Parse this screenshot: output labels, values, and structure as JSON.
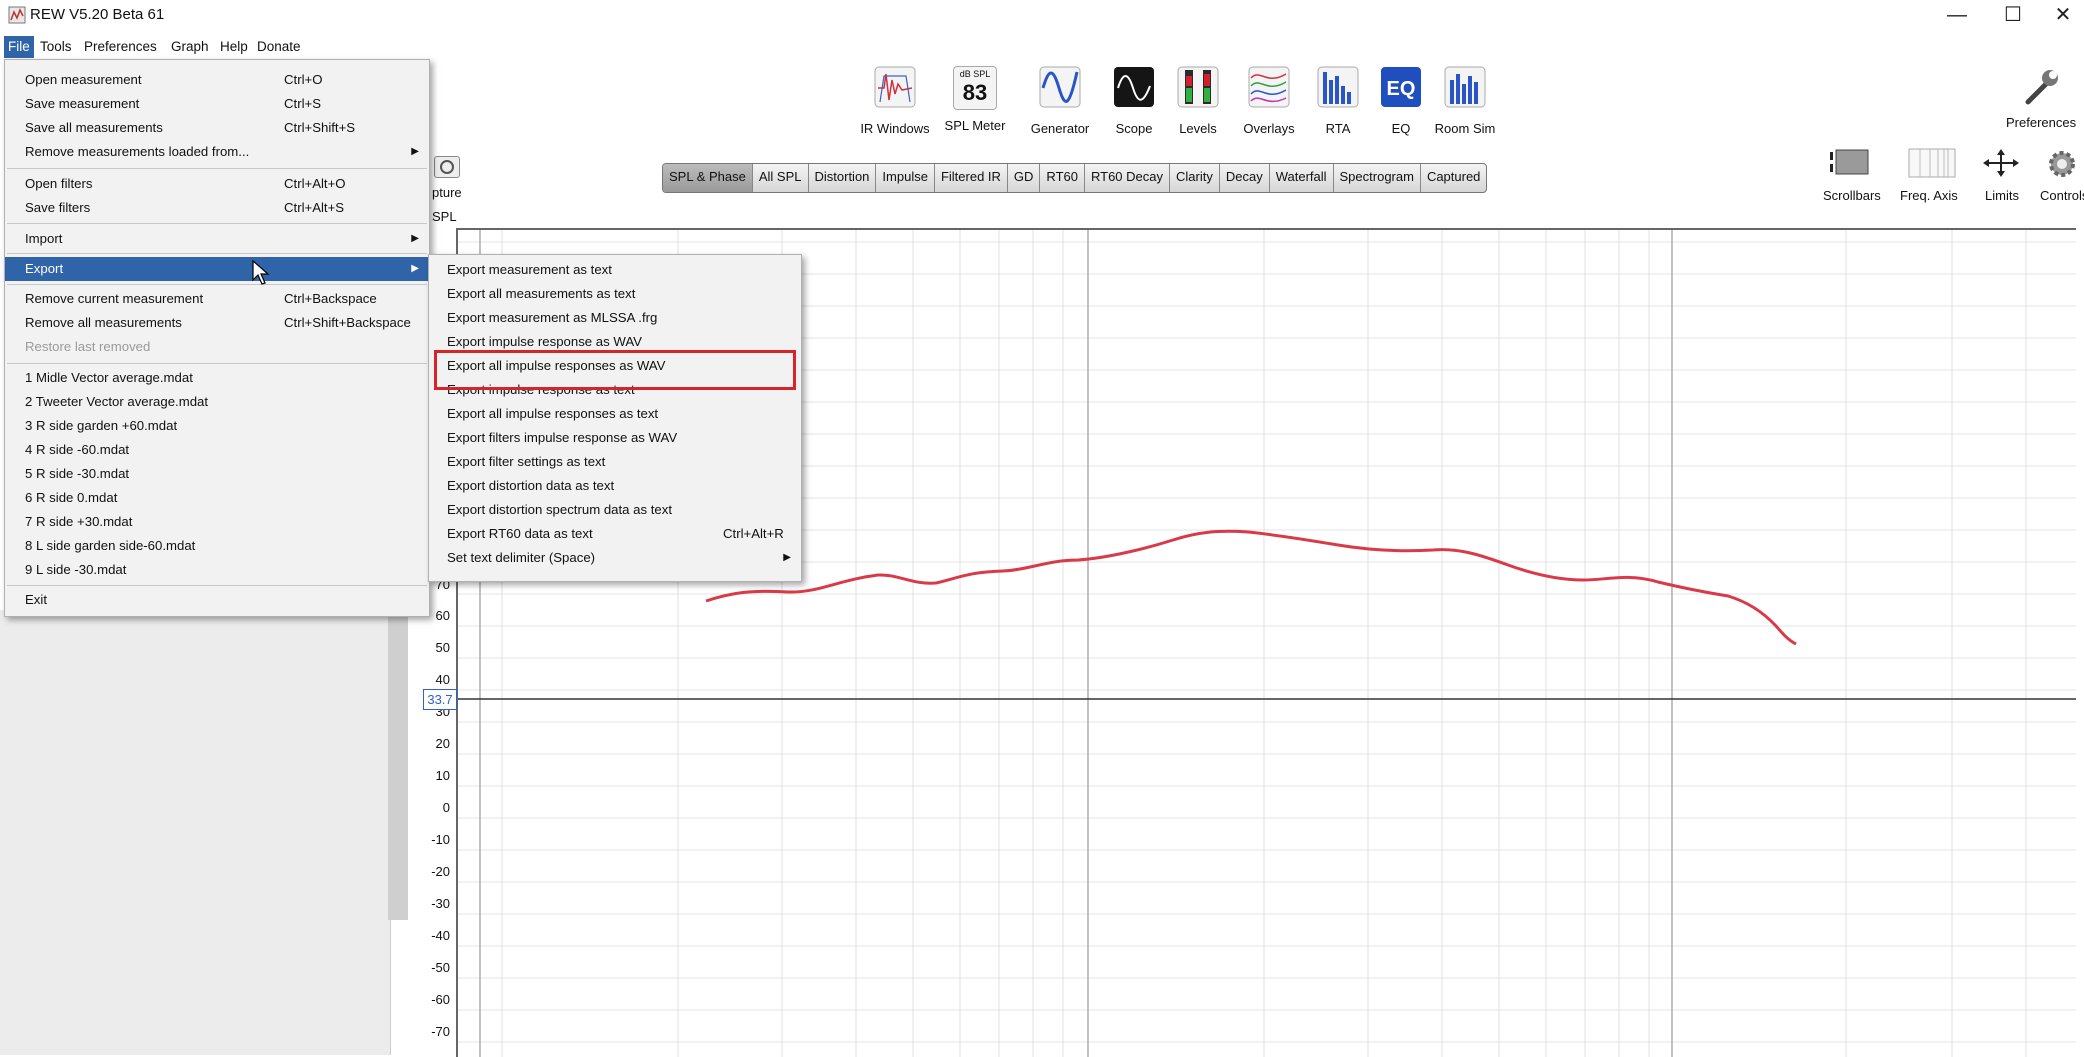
{
  "window": {
    "title": "REW V5.20 Beta 61",
    "controls": {
      "minimize": "—",
      "maximize": "☐",
      "close": "✕"
    }
  },
  "menubar": [
    {
      "label": "File",
      "active": true
    },
    {
      "label": "Tools"
    },
    {
      "label": "Preferences"
    },
    {
      "label": "Graph"
    },
    {
      "label": "Help"
    },
    {
      "label": "Donate"
    }
  ],
  "toolbar": [
    {
      "label": "IR Windows",
      "icon": "ir-windows-icon"
    },
    {
      "label": "SPL Meter",
      "icon": "spl-meter-icon",
      "top": "dB SPL",
      "value": "83"
    },
    {
      "label": "Generator",
      "icon": "generator-icon"
    },
    {
      "label": "Scope",
      "icon": "scope-icon"
    },
    {
      "label": "Levels",
      "icon": "levels-icon"
    },
    {
      "label": "Overlays",
      "icon": "overlays-icon"
    },
    {
      "label": "RTA",
      "icon": "rta-icon"
    },
    {
      "label": "EQ",
      "icon": "eq-icon"
    },
    {
      "label": "Room Sim",
      "icon": "room-sim-icon"
    }
  ],
  "right_toolbar": {
    "preferences": "Preferences",
    "scrollbars": "Scrollbars",
    "freq_axis": "Freq. Axis",
    "limits": "Limits",
    "controls": "Controls"
  },
  "capture_label": "pture",
  "spl_label": "SPL",
  "tabs": [
    "SPL & Phase",
    "All SPL",
    "Distortion",
    "Impulse",
    "Filtered IR",
    "GD",
    "RT60",
    "RT60 Decay",
    "Clarity",
    "Decay",
    "Waterfall",
    "Spectrogram",
    "Captured"
  ],
  "selected_tab": "SPL & Phase",
  "graph": {
    "y_ticks": [
      "70",
      "60",
      "50",
      "40",
      "30",
      "20",
      "10",
      "0",
      "-10",
      "-20",
      "-30",
      "-40",
      "-50",
      "-60",
      "-70"
    ],
    "cursor_value": "33.7",
    "trace_color": "#d93a48"
  },
  "file_menu": {
    "items": [
      {
        "label": "Open measurement",
        "accel": "Ctrl+O"
      },
      {
        "label": "Save measurement",
        "accel": "Ctrl+S"
      },
      {
        "label": "Save all measurements",
        "accel": "Ctrl+Shift+S"
      },
      {
        "label": "Remove measurements loaded from...",
        "submenu": true
      },
      {
        "sep": true
      },
      {
        "label": "Open filters",
        "accel": "Ctrl+Alt+O"
      },
      {
        "label": "Save filters",
        "accel": "Ctrl+Alt+S"
      },
      {
        "sep": true
      },
      {
        "label": "Import",
        "submenu": true
      },
      {
        "sep": true
      },
      {
        "label": "Export",
        "submenu": true,
        "selected": true
      },
      {
        "sep": true
      },
      {
        "label": "Remove current measurement",
        "accel": "Ctrl+Backspace"
      },
      {
        "label": "Remove all measurements",
        "accel": "Ctrl+Shift+Backspace"
      },
      {
        "label": "Restore last removed",
        "disabled": true
      },
      {
        "sep": true
      },
      {
        "label": "1 Midle Vector average.mdat"
      },
      {
        "label": "2 Tweeter Vector average.mdat"
      },
      {
        "label": "3 R side garden +60.mdat"
      },
      {
        "label": "4 R side -60.mdat"
      },
      {
        "label": "5 R side -30.mdat"
      },
      {
        "label": "6 R side 0.mdat"
      },
      {
        "label": "7 R side +30.mdat"
      },
      {
        "label": "8 L side garden side-60.mdat"
      },
      {
        "label": "9 L side -30.mdat"
      },
      {
        "sep": true
      },
      {
        "label": "Exit"
      }
    ]
  },
  "export_menu": {
    "items": [
      {
        "label": "Export measurement as text"
      },
      {
        "label": "Export all measurements as text"
      },
      {
        "label": "Export measurement as MLSSA .frg"
      },
      {
        "label": "Export impulse response as WAV"
      },
      {
        "label": "Export all impulse responses as WAV",
        "highlighted": true
      },
      {
        "label": "Export impulse response as text"
      },
      {
        "label": "Export all impulse responses as text"
      },
      {
        "label": "Export filters impulse response as WAV"
      },
      {
        "label": "Export filter settings as text"
      },
      {
        "label": "Export distortion data as text"
      },
      {
        "label": "Export distortion spectrum data as text"
      },
      {
        "label": "Export RT60 data as text",
        "accel": "Ctrl+Alt+R"
      },
      {
        "label": "Set text delimiter (Space)",
        "submenu": true
      }
    ],
    "highlight_color": "#d6252a"
  }
}
